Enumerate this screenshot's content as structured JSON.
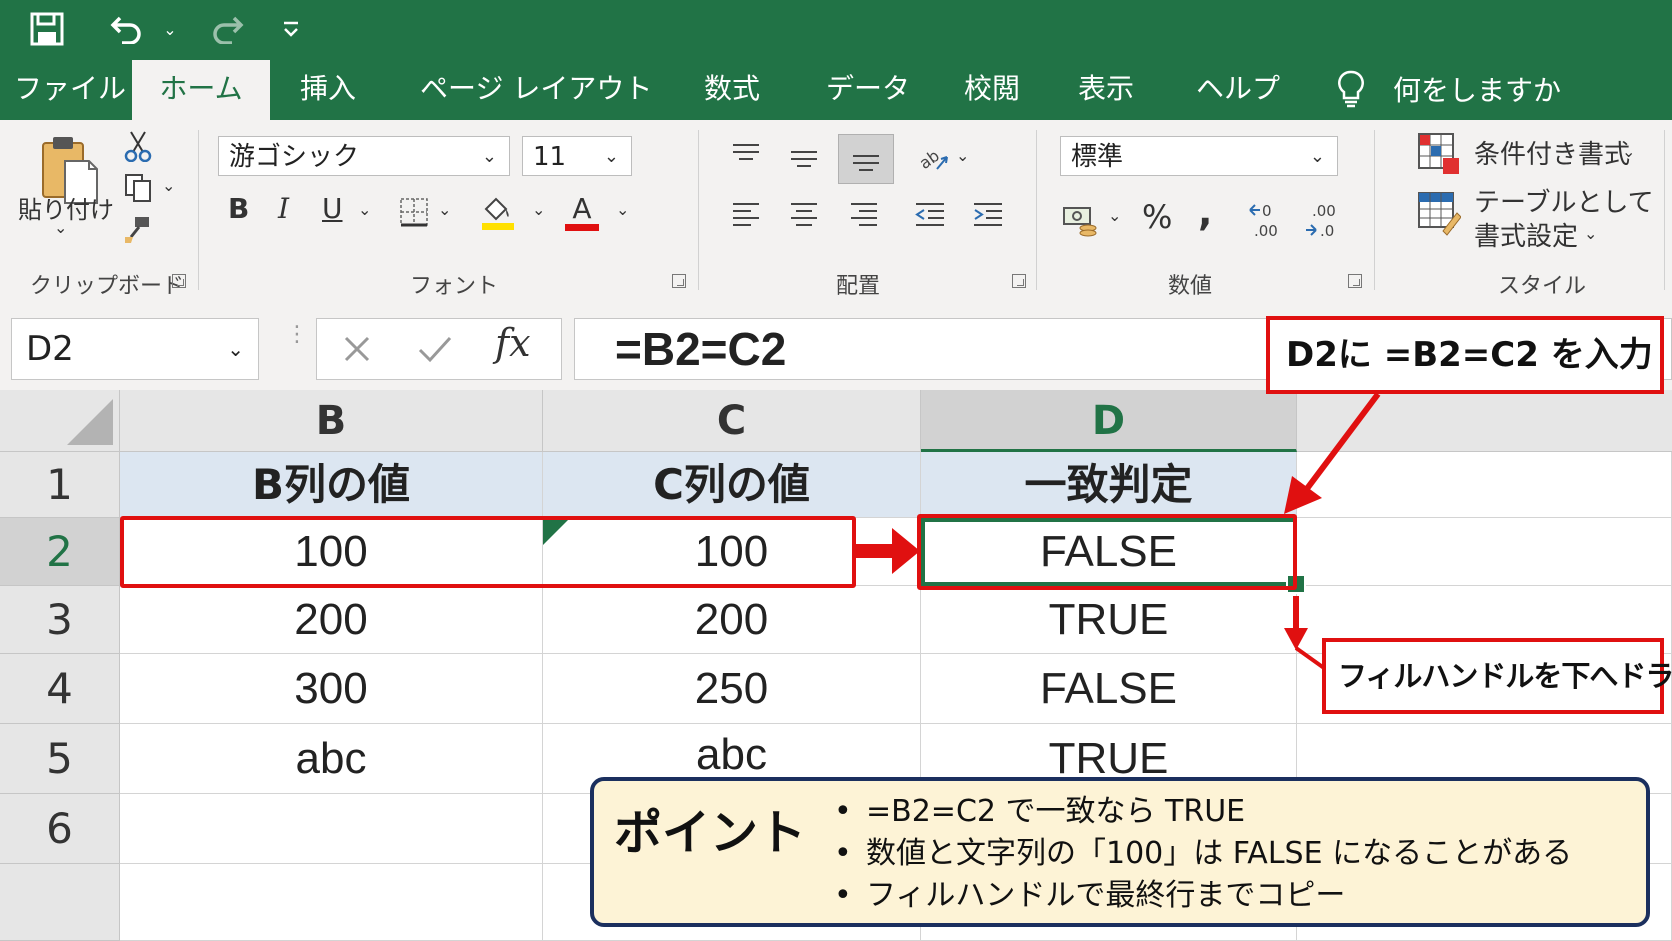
{
  "title": "",
  "tabs": [
    "ファイル",
    "ホーム",
    "挿入",
    "ページ レイアウト",
    "数式",
    "データ",
    "校閲",
    "表示",
    "ヘルプ"
  ],
  "active_tab": "ホーム",
  "tell_me": "何をしますか",
  "ribbon": {
    "clipboard": {
      "label": "クリップボード",
      "paste": "貼り付け"
    },
    "font": {
      "label": "フォント",
      "name": "游ゴシック",
      "size": "11",
      "bold": "B",
      "italic": "I",
      "underline": "U",
      "font_color_glyph": "A",
      "fill_color": "#ffe000",
      "font_color": "#e01010"
    },
    "alignment": {
      "label": "配置"
    },
    "number": {
      "label": "数値",
      "format": "標準",
      "percent": "%",
      "comma": ","
    },
    "styles": {
      "label": "スタイル",
      "conditional": "条件付き書式",
      "table_line1": "テーブルとして",
      "table_line2": "書式設定"
    }
  },
  "formula_bar": {
    "name_box": "D2",
    "formula": "=B2=C2",
    "fx": "fx"
  },
  "sheet": {
    "columns": [
      "B",
      "C",
      "D"
    ],
    "selected_column": "D",
    "rows": [
      "1",
      "2",
      "3",
      "4",
      "5",
      "6"
    ],
    "selected_row": "2",
    "cells": [
      [
        "B列の値",
        "C列の値",
        "一致判定"
      ],
      [
        "100",
        "100",
        "FALSE"
      ],
      [
        "200",
        "200",
        "TRUE"
      ],
      [
        "300",
        "250",
        "FALSE"
      ],
      [
        "abc",
        "abc",
        "TRUE"
      ],
      [
        "",
        "",
        ""
      ]
    ]
  },
  "annotations": {
    "callout_input": "D2に =B2=C2 を入力",
    "callout_drag": "フィルハンドルを下へドラッグ",
    "point_title": "ポイント",
    "point_items": [
      "=B2=C2 で一致なら TRUE",
      "数値と文字列の「100」は FALSE になることがある",
      "フィルハンドルで最終行までコピー"
    ]
  },
  "colors": {
    "excel_green": "#217346",
    "annotation_red": "#e01010",
    "header_fill": "#dce6f1",
    "point_bg": "#fdf3d6",
    "point_border": "#1b2f5e"
  }
}
